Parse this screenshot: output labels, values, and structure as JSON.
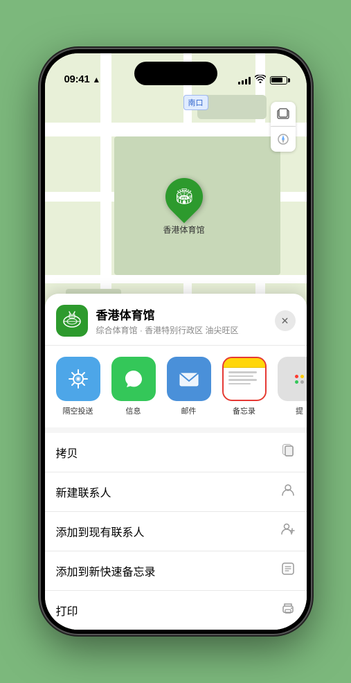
{
  "status_bar": {
    "time": "09:41",
    "location_arrow": "▲"
  },
  "map": {
    "label_text": "南口",
    "controls": {
      "layers_icon": "🗺",
      "compass_icon": "◎"
    },
    "marker_label": "香港体育馆"
  },
  "bottom_sheet": {
    "venue_icon": "🏟",
    "venue_name": "香港体育馆",
    "venue_desc": "综合体育馆 · 香港特别行政区 油尖旺区",
    "close_label": "✕",
    "share_items": [
      {
        "label": "隔空投送",
        "type": "airdrop",
        "icon": "📡"
      },
      {
        "label": "信息",
        "type": "messages",
        "icon": "💬"
      },
      {
        "label": "邮件",
        "type": "mail",
        "icon": "✉"
      },
      {
        "label": "备忘录",
        "type": "notes",
        "icon": "notes"
      }
    ],
    "more_label": "提",
    "actions": [
      {
        "label": "拷贝",
        "icon": "⎘"
      },
      {
        "label": "新建联系人",
        "icon": "👤"
      },
      {
        "label": "添加到现有联系人",
        "icon": "👤+"
      },
      {
        "label": "添加到新快速备忘录",
        "icon": "⊡"
      },
      {
        "label": "打印",
        "icon": "🖨"
      }
    ]
  }
}
